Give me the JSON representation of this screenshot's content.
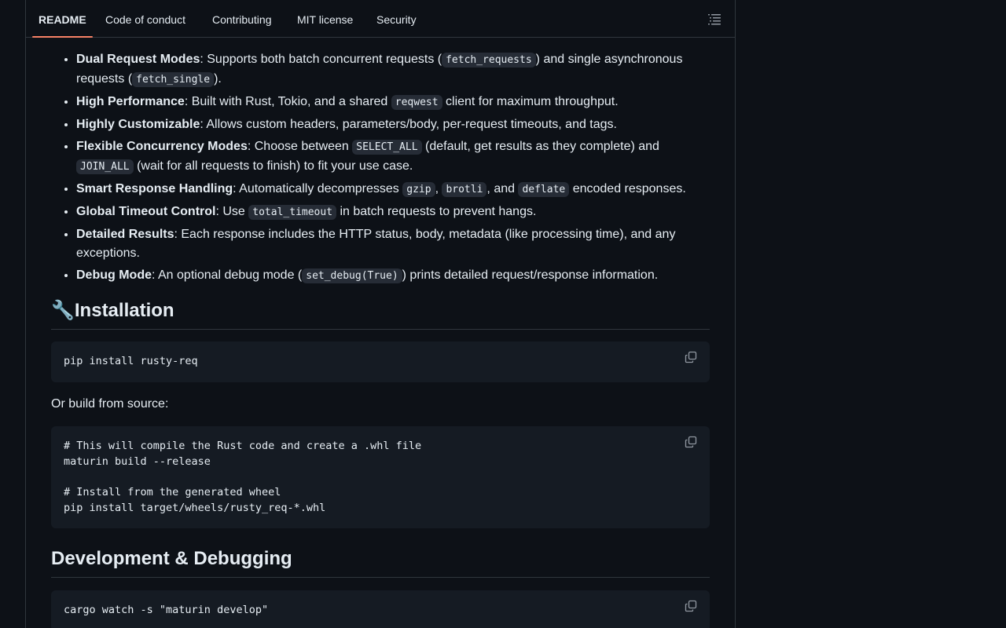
{
  "tabs": [
    {
      "label": "README",
      "active": true
    },
    {
      "label": "Code of conduct"
    },
    {
      "label": "Contributing"
    },
    {
      "label": "MIT license"
    },
    {
      "label": "Security"
    }
  ],
  "features": [
    {
      "title": "Dual Request Modes",
      "t1": ": Supports both batch concurrent requests (",
      "c1": "fetch_requests",
      "t2": ") and single asynchronous requests (",
      "c2": "fetch_single",
      "t3": ")."
    },
    {
      "title": "High Performance",
      "t1": ": Built with Rust, Tokio, and a shared ",
      "c1": "reqwest",
      "t2": " client for maximum throughput."
    },
    {
      "title": "Highly Customizable",
      "t1": ": Allows custom headers, parameters/body, per-request timeouts, and tags."
    },
    {
      "title": "Flexible Concurrency Modes",
      "t1": ": Choose between ",
      "c1": "SELECT_ALL",
      "t2": " (default, get results as they complete) and ",
      "c2": "JOIN_ALL",
      "t3": " (wait for all requests to finish) to fit your use case."
    },
    {
      "title": "Smart Response Handling",
      "t1": ": Automatically decompresses ",
      "c1": "gzip",
      "t2": ", ",
      "c2": "brotli",
      "t3": ", and ",
      "c3": "deflate",
      "t4": " encoded responses."
    },
    {
      "title": "Global Timeout Control",
      "t1": ": Use ",
      "c1": "total_timeout",
      "t2": " in batch requests to prevent hangs."
    },
    {
      "title": "Detailed Results",
      "t1": ": Each response includes the HTTP status, body, metadata (like processing time), and any exceptions."
    },
    {
      "title": "Debug Mode",
      "t1": ": An optional debug mode (",
      "c1": "set_debug(True)",
      "t2": ") prints detailed request/response information."
    }
  ],
  "installation": {
    "icon": "🔧",
    "heading": "Installation",
    "code1": "pip install rusty-req",
    "or_text": "Or build from source:",
    "code2": "# This will compile the Rust code and create a .whl file\nmaturin build --release\n\n# Install from the generated wheel\npip install target/wheels/rusty_req-*.whl"
  },
  "development": {
    "heading": "Development & Debugging",
    "code1": "cargo watch -s \"maturin develop\""
  }
}
